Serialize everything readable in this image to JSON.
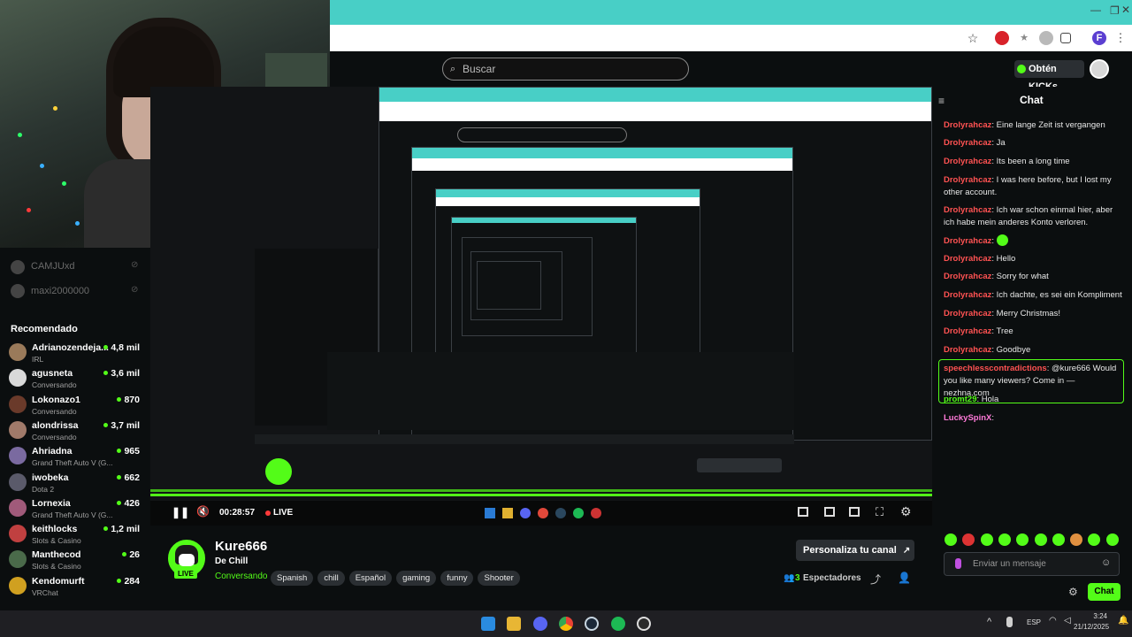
{
  "search": {
    "placeholder": "Buscar"
  },
  "header": {
    "kicks_label": "Obtén KICKs"
  },
  "sidebar": {
    "offline": [
      "CAMJUxd",
      "maxi2000000"
    ],
    "section_title": "Recomendado",
    "recommended": [
      {
        "name": "Adrianozendeja...",
        "category": "IRL",
        "viewers": "4,8 mil",
        "color": "#9a7a5a"
      },
      {
        "name": "agusneta",
        "category": "Conversando",
        "viewers": "3,6 mil",
        "color": "#d9d9d9"
      },
      {
        "name": "Lokonazo1",
        "category": "Conversando",
        "viewers": "870",
        "color": "#6a3a2a"
      },
      {
        "name": "alondrissa",
        "category": "Conversando",
        "viewers": "3,7 mil",
        "color": "#a07a6a"
      },
      {
        "name": "Ahriadna",
        "category": "Grand Theft Auto V (G...",
        "viewers": "965",
        "color": "#7a6aa0"
      },
      {
        "name": "iwobeka",
        "category": "Dota 2",
        "viewers": "662",
        "color": "#5a5a6a"
      },
      {
        "name": "Lornexia",
        "category": "Grand Theft Auto V (G...",
        "viewers": "426",
        "color": "#a05a7a"
      },
      {
        "name": "keithlocks",
        "category": "Slots & Casino",
        "viewers": "1,2 mil",
        "color": "#c04040"
      },
      {
        "name": "Manthecod",
        "category": "Slots & Casino",
        "viewers": "26",
        "color": "#4a6a4a"
      },
      {
        "name": "Kendomurft",
        "category": "VRChat",
        "viewers": "284",
        "color": "#d0a020"
      }
    ]
  },
  "player": {
    "time": "00:28:57",
    "live_label": "LIVE"
  },
  "channel": {
    "name": "Kure666",
    "title": "De Chill",
    "category": "Conversando",
    "tags": [
      "Spanish",
      "chill",
      "Español",
      "gaming",
      "funny",
      "Shooter"
    ],
    "customize_label": "Personaliza tu canal",
    "viewer_count": "3",
    "viewer_label": "Espectadores",
    "avatar_badge": "LIVE"
  },
  "chat": {
    "title": "Chat",
    "messages": [
      {
        "user": "Drolyrahcaz",
        "text": "Eine lange Zeit ist vergangen"
      },
      {
        "user": "Drolyrahcaz",
        "text": "Ja"
      },
      {
        "user": "Drolyrahcaz",
        "text": "Its been a long time"
      },
      {
        "user": "Drolyrahcaz",
        "text": "I was here before, but I lost my other account."
      },
      {
        "user": "Drolyrahcaz",
        "text": "Ich war schon einmal hier, aber ich habe mein anderes Konto verloren."
      },
      {
        "user": "Drolyrahcaz",
        "text": ""
      },
      {
        "user": "Drolyrahcaz",
        "text": "Hello"
      },
      {
        "user": "Drolyrahcaz",
        "text": "Sorry for what"
      },
      {
        "user": "Drolyrahcaz",
        "text": "Ich dachte, es sei ein Kompliment"
      },
      {
        "user": "Drolyrahcaz",
        "text": "Merry Christmas!"
      },
      {
        "user": "Drolyrahcaz",
        "text": "Tree"
      },
      {
        "user": "Drolyrahcaz",
        "text": "Goodbye"
      }
    ],
    "highlight": {
      "user": "speechlesscontradictions",
      "text": "@kure666 Would you like many viewers? Come in — nezhna.com"
    },
    "after": [
      {
        "user": "promt29",
        "text": "Hola"
      },
      {
        "user": "LuckySpinX",
        "text": ""
      }
    ],
    "input_placeholder": "Enviar un mensaje",
    "send_label": "Chat"
  },
  "taskbar": {
    "lang": "ESP",
    "time": "3:24",
    "date": "21/12/2025"
  },
  "colors": {
    "accent": "#53fc18",
    "browser_tab": "#48cfc6"
  }
}
